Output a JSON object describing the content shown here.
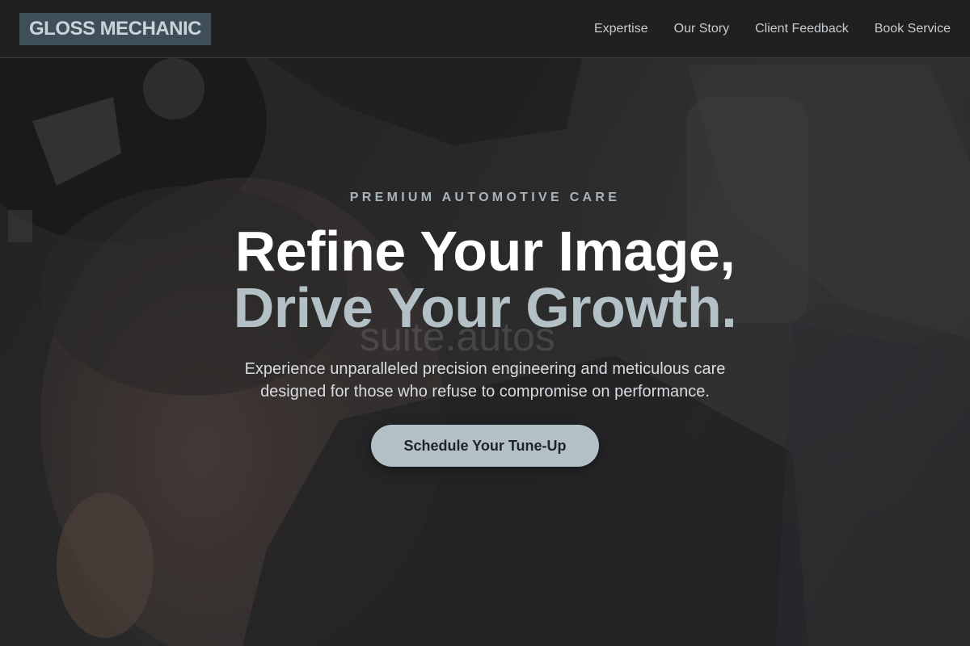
{
  "brand": {
    "name": "GLOSS MECHANIC"
  },
  "nav": {
    "items": [
      {
        "label": "Expertise"
      },
      {
        "label": "Our Story"
      },
      {
        "label": "Client Feedback"
      },
      {
        "label": "Book Service"
      }
    ]
  },
  "hero": {
    "eyebrow": "PREMIUM AUTOMOTIVE CARE",
    "headline_line1": "Refine Your Image,",
    "headline_line2": "Drive Your Growth.",
    "watermark": "suite.autos",
    "subtext": "Experience unparalleled precision engineering and meticulous care designed for those who refuse to compromise on performance.",
    "cta_label": "Schedule Your Tune-Up",
    "background_image": "mechanic working under vehicle photo"
  },
  "colors": {
    "nav_bg": "#202020",
    "logo_bg": "#3f4f58",
    "accent": "#b3c0c6",
    "eyebrow": "#a9b5bb"
  }
}
